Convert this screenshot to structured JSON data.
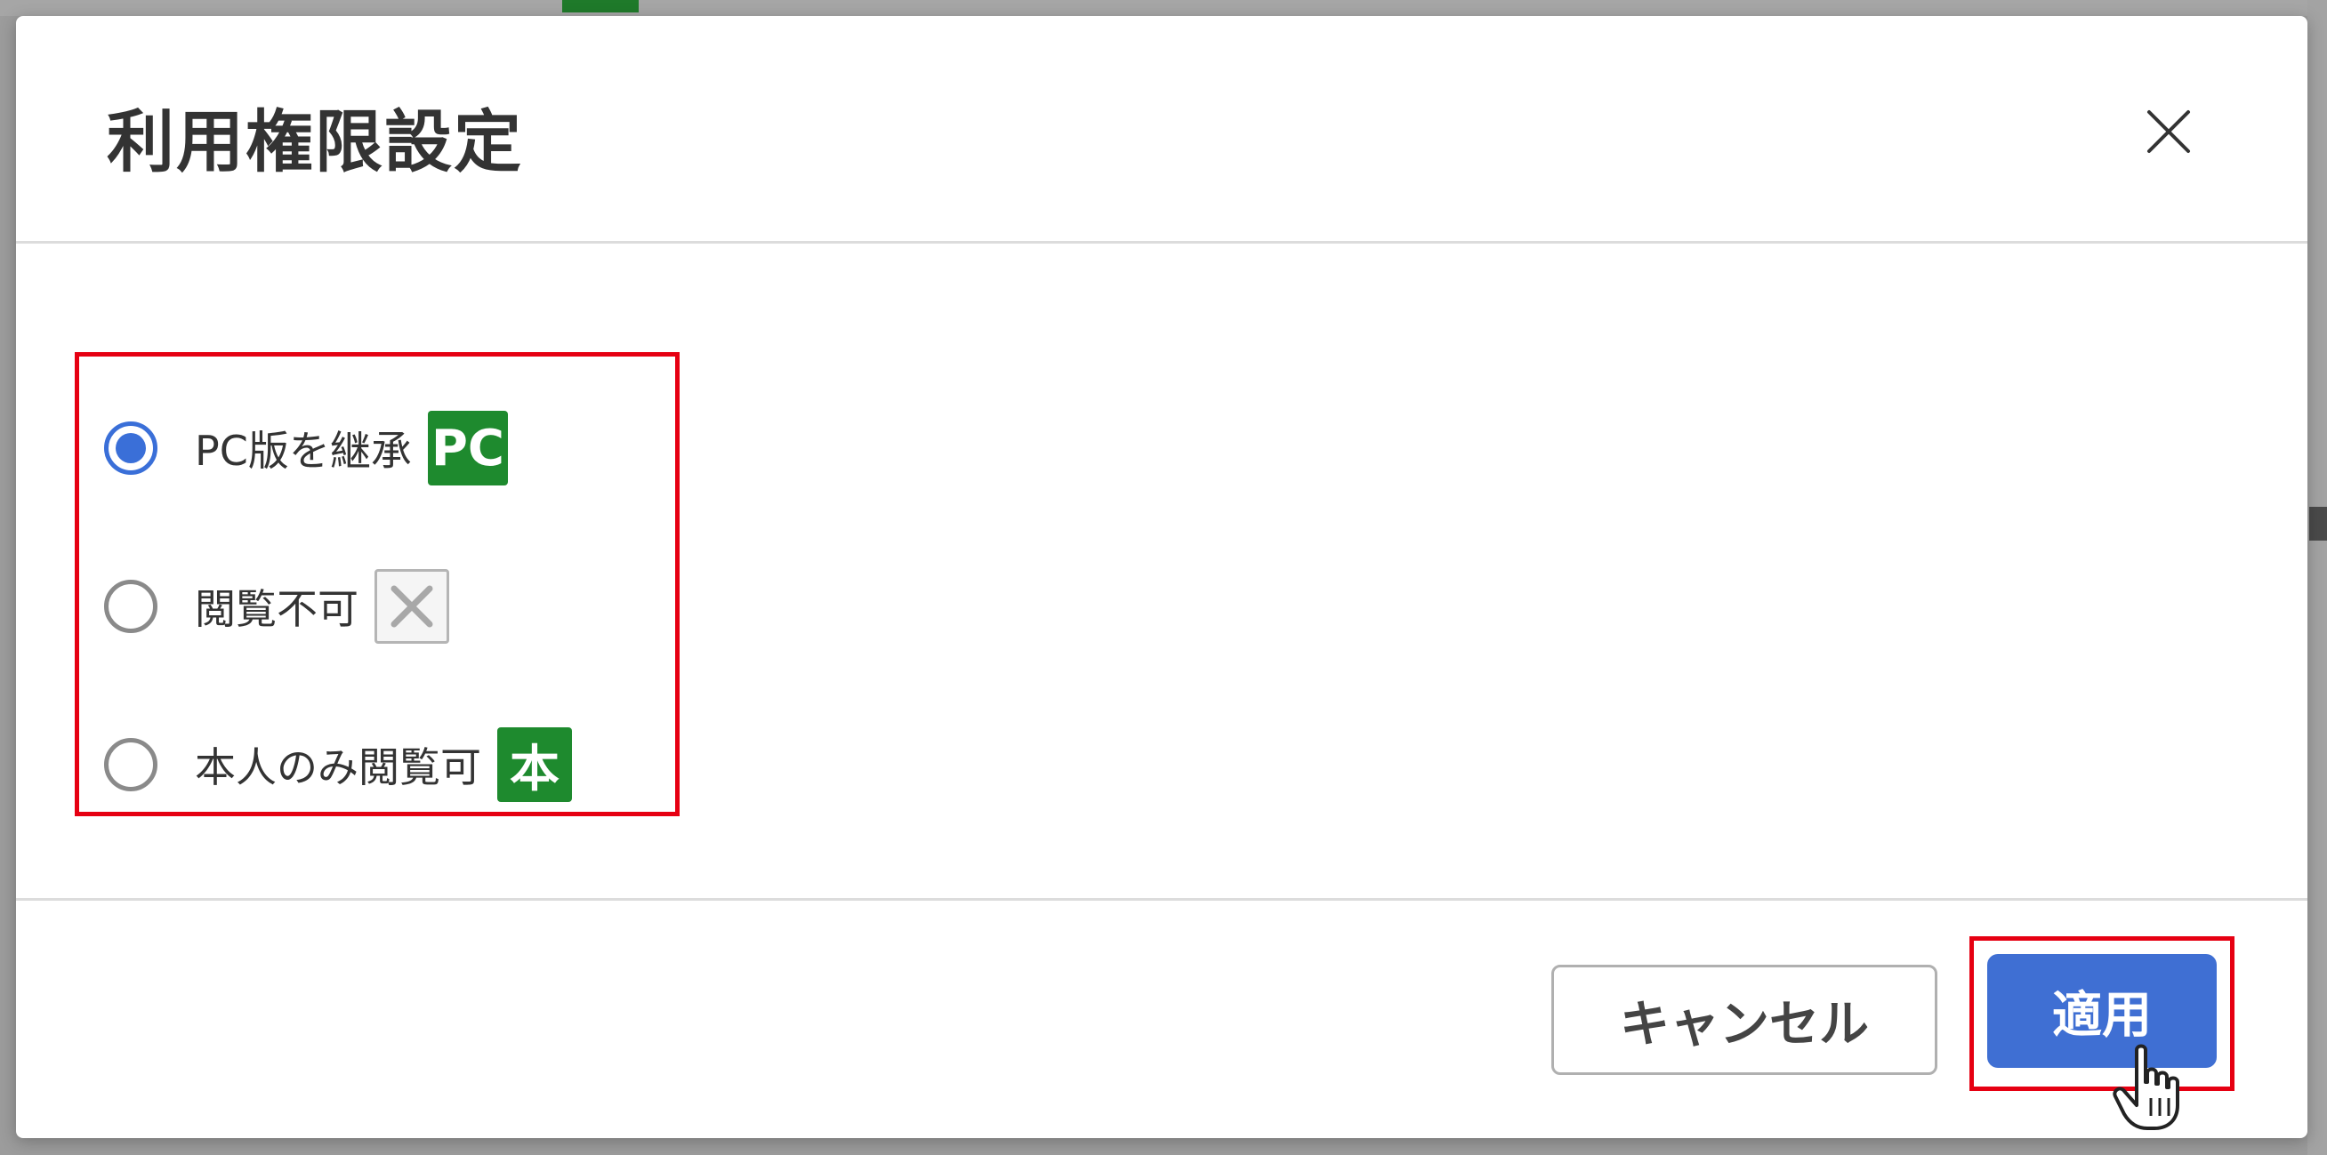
{
  "dialog": {
    "title": "利用権限設定",
    "close_icon": "close-icon"
  },
  "options": [
    {
      "label": "PC版を継承",
      "badge": "PC",
      "badge_color": "#1e8a2e",
      "checked": true
    },
    {
      "label": "閲覧不可",
      "badge_icon": "cross-icon",
      "checked": false
    },
    {
      "label": "本人のみ閲覧可",
      "badge": "本",
      "badge_color": "#1e8a2e",
      "checked": false
    }
  ],
  "footer": {
    "cancel_label": "キャンセル",
    "apply_label": "適用"
  },
  "colors": {
    "accent": "#3f6fd3",
    "highlight": "#e60012",
    "badge_green": "#1e8a2e"
  }
}
